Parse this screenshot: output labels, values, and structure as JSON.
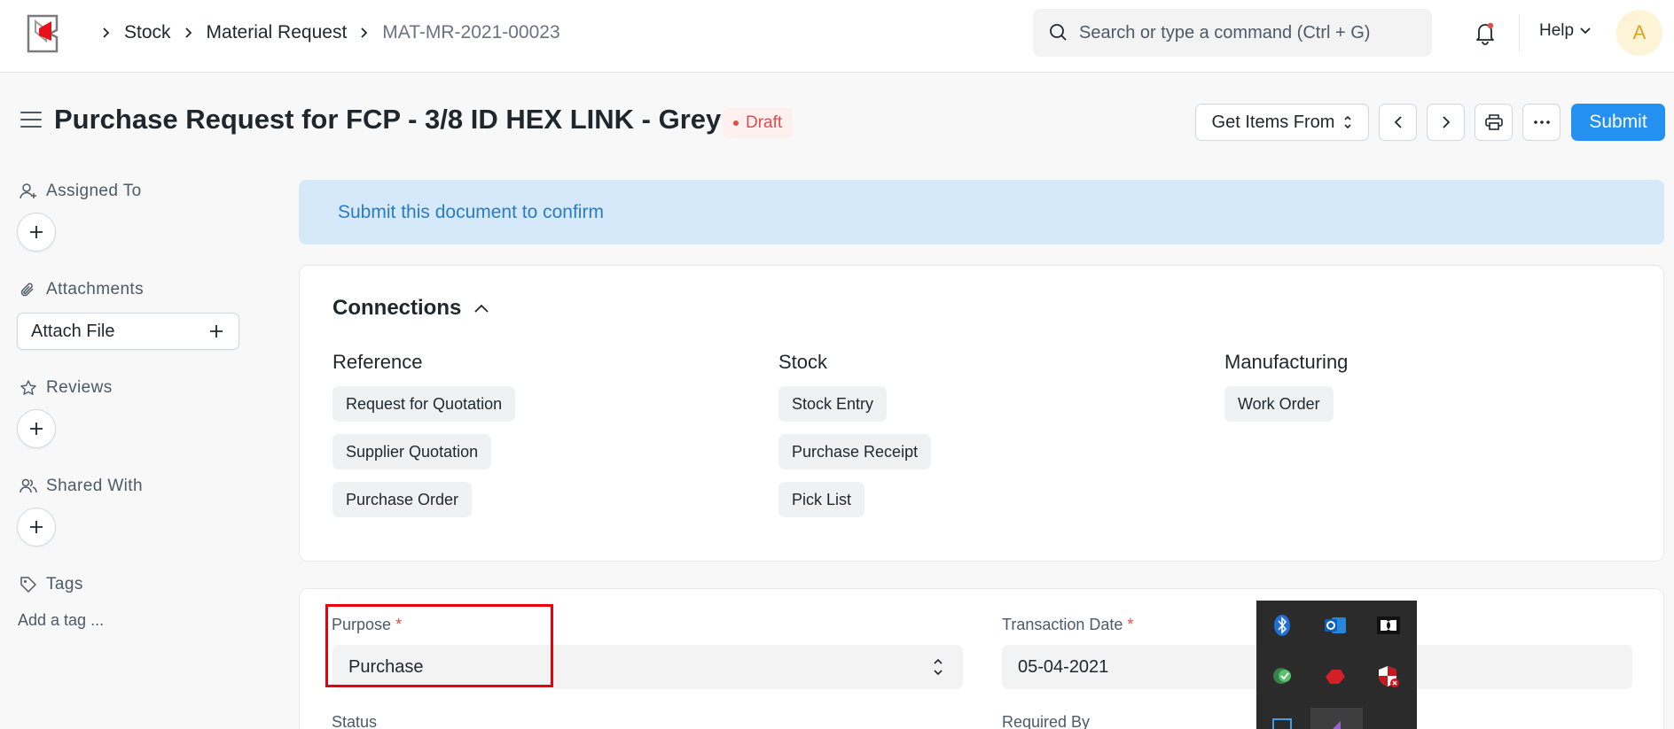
{
  "navbar": {
    "breadcrumbs": [
      "Stock",
      "Material Request",
      "MAT-MR-2021-00023"
    ],
    "search_placeholder": "Search or type a command (Ctrl + G)",
    "help_label": "Help",
    "avatar_initial": "A"
  },
  "header": {
    "title": "Purchase Request for FCP - 3/8 ID HEX LINK - Grey",
    "status": "Draft",
    "get_items_label": "Get Items From",
    "submit_label": "Submit"
  },
  "sidebar": {
    "assigned_to": "Assigned To",
    "attachments": "Attachments",
    "attach_file": "Attach File",
    "reviews": "Reviews",
    "shared_with": "Shared With",
    "tags": "Tags",
    "add_tag": "Add a tag ..."
  },
  "alert": {
    "message": "Submit this document to confirm"
  },
  "connections": {
    "title": "Connections",
    "columns": [
      {
        "heading": "Reference",
        "items": [
          "Request for Quotation",
          "Supplier Quotation",
          "Purchase Order"
        ]
      },
      {
        "heading": "Stock",
        "items": [
          "Stock Entry",
          "Purchase Receipt",
          "Pick List"
        ]
      },
      {
        "heading": "Manufacturing",
        "items": [
          "Work Order"
        ]
      }
    ]
  },
  "form": {
    "purpose_label": "Purpose",
    "purpose_value": "Purchase",
    "transaction_date_label": "Transaction Date",
    "transaction_date_value": "05-04-2021",
    "status_label": "Status",
    "required_by_label": "Required By",
    "required_marker": "*"
  },
  "colors": {
    "primary": "#2490ef",
    "draft": "#e24c4c",
    "alert_bg": "#d5e9fb",
    "highlight_box": "#e8000b"
  }
}
